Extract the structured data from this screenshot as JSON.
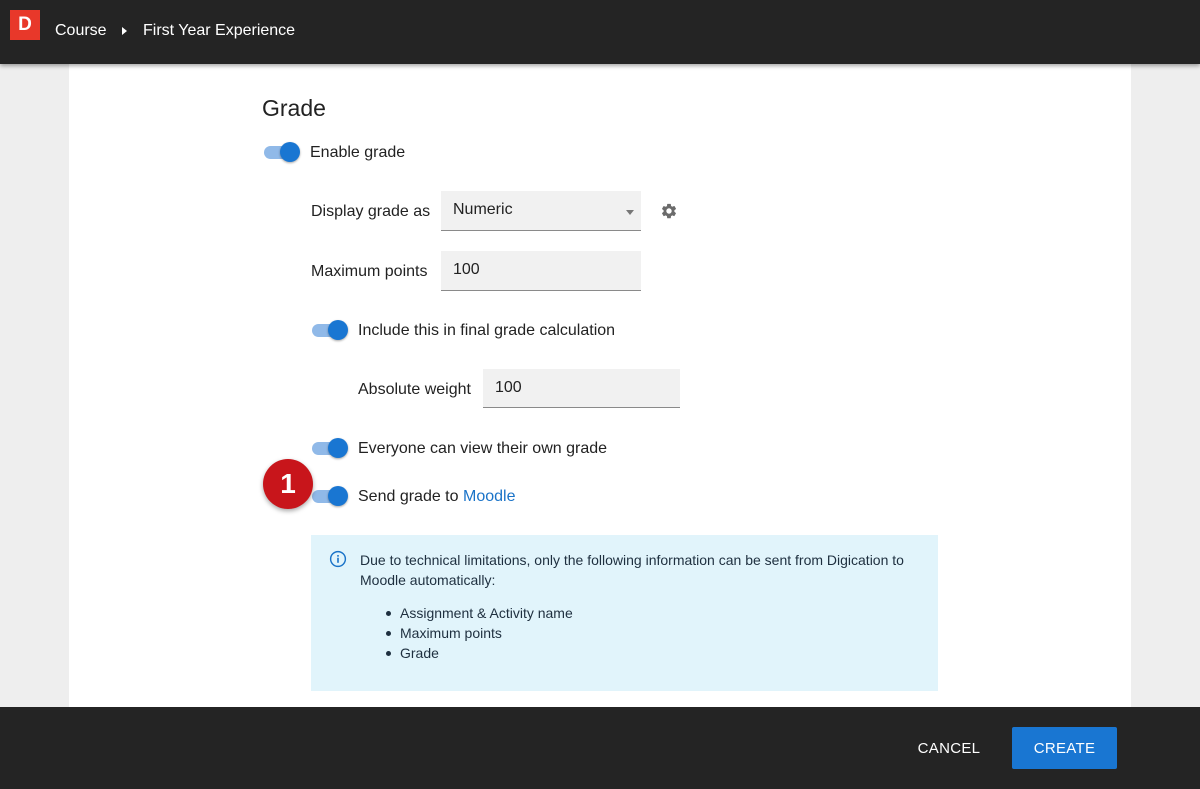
{
  "topbar": {
    "logo_letter": "D",
    "breadcrumb": [
      "Course",
      "First Year Experience"
    ]
  },
  "grade": {
    "heading": "Grade",
    "enable_grade": {
      "label": "Enable grade",
      "checked": true
    },
    "display_grade_as": {
      "label": "Display grade as",
      "value": "Numeric"
    },
    "maximum_points": {
      "label": "Maximum points",
      "value": "100"
    },
    "include_final": {
      "label": "Include this in final grade calculation",
      "checked": true
    },
    "absolute_weight": {
      "label": "Absolute weight",
      "value": "100"
    },
    "view_own_grade": {
      "label": "Everyone can view their own grade",
      "checked": true
    },
    "send_grade": {
      "label": "Send grade to",
      "link": "Moodle",
      "checked": true
    }
  },
  "callout": {
    "number": "1",
    "color": "#c8151b"
  },
  "info": {
    "text": "Due to technical limitations, only the following information can be sent from Digication to Moodle automatically:",
    "items": [
      "Assignment & Activity name",
      "Maximum points",
      "Grade"
    ]
  },
  "footer": {
    "cancel_label": "CANCEL",
    "create_label": "CREATE"
  },
  "colors": {
    "accent": "#1976d2",
    "topbar": "#242424",
    "logo": "#e8382a",
    "info_bg": "#e1f4fb"
  },
  "icons": {
    "settings": "gear-icon",
    "info": "info-icon",
    "breadcrumb_separator": "chevron-right-icon"
  }
}
